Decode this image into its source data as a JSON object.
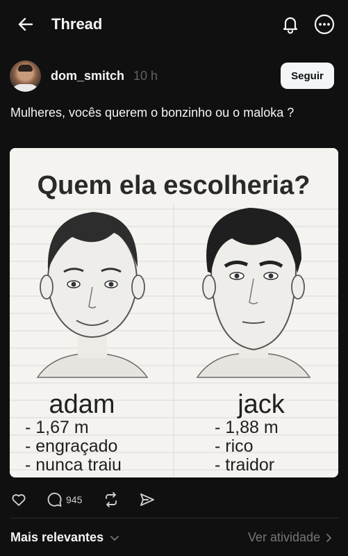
{
  "header": {
    "title": "Thread",
    "back_icon": "arrow-left-icon",
    "bell_icon": "bell-icon",
    "more_icon": "more-circle-icon"
  },
  "post": {
    "username": "dom_smitch",
    "timestamp": "10 h",
    "follow_label": "Seguir",
    "text": "Mulheres, vocês querem o bonzinho ou o maloka ?",
    "image": {
      "heading": "Quem ela escolheria?",
      "left_name": "adam",
      "left_traits": [
        "- 1,67 m",
        "- engraçado",
        "- nunca traiu"
      ],
      "right_name": "jack",
      "right_traits": [
        "- 1,88 m",
        "- rico",
        "- traidor"
      ]
    },
    "comment_count": "945"
  },
  "footer": {
    "sort_label": "Mais relevantes",
    "activity_label": "Ver atividade"
  },
  "colors": {
    "background": "#101010",
    "text": "#f3f5f7",
    "muted": "#616161",
    "button_bg": "#f3f5f7"
  }
}
